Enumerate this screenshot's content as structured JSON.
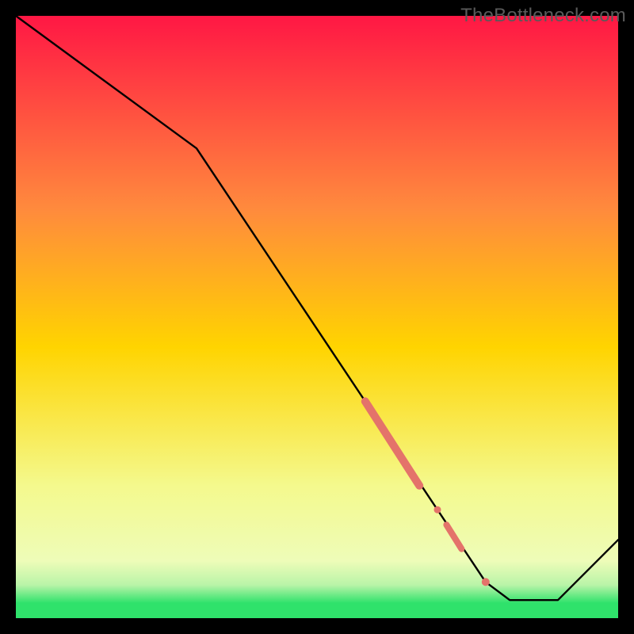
{
  "watermark": "TheBottleneck.com",
  "colors": {
    "top": "#ff1744",
    "mid_upper": "#ff8a3d",
    "mid": "#ffd400",
    "mid_lower": "#f4f98d",
    "pale": "#eefcb8",
    "green_pale": "#b9f4a8",
    "green": "#2fe26b",
    "frame": "#000000",
    "line": "#000000",
    "marker": "#e4736a"
  },
  "chart_data": {
    "type": "line",
    "title": "",
    "xlabel": "",
    "ylabel": "",
    "xlim": [
      0,
      100
    ],
    "ylim": [
      0,
      100
    ],
    "x": [
      0,
      30,
      78,
      82,
      90,
      100
    ],
    "values": [
      100,
      78,
      6,
      3,
      3,
      13
    ],
    "markers": [
      {
        "kind": "segment",
        "x0": 58,
        "y0": 36,
        "x1": 67,
        "y1": 22,
        "width": 10
      },
      {
        "kind": "dot",
        "x": 70,
        "y": 18,
        "r": 4.5
      },
      {
        "kind": "segment",
        "x0": 71.5,
        "y0": 15.5,
        "x1": 74,
        "y1": 11.5,
        "width": 8
      },
      {
        "kind": "dot",
        "x": 78,
        "y": 6,
        "r": 5
      }
    ],
    "gradient_stops": [
      {
        "offset": 0.0,
        "color_key": "top"
      },
      {
        "offset": 0.32,
        "color_key": "mid_upper"
      },
      {
        "offset": 0.55,
        "color_key": "mid"
      },
      {
        "offset": 0.78,
        "color_key": "mid_lower"
      },
      {
        "offset": 0.905,
        "color_key": "pale"
      },
      {
        "offset": 0.945,
        "color_key": "green_pale"
      },
      {
        "offset": 0.975,
        "color_key": "green"
      }
    ],
    "frame_thickness": 20
  }
}
